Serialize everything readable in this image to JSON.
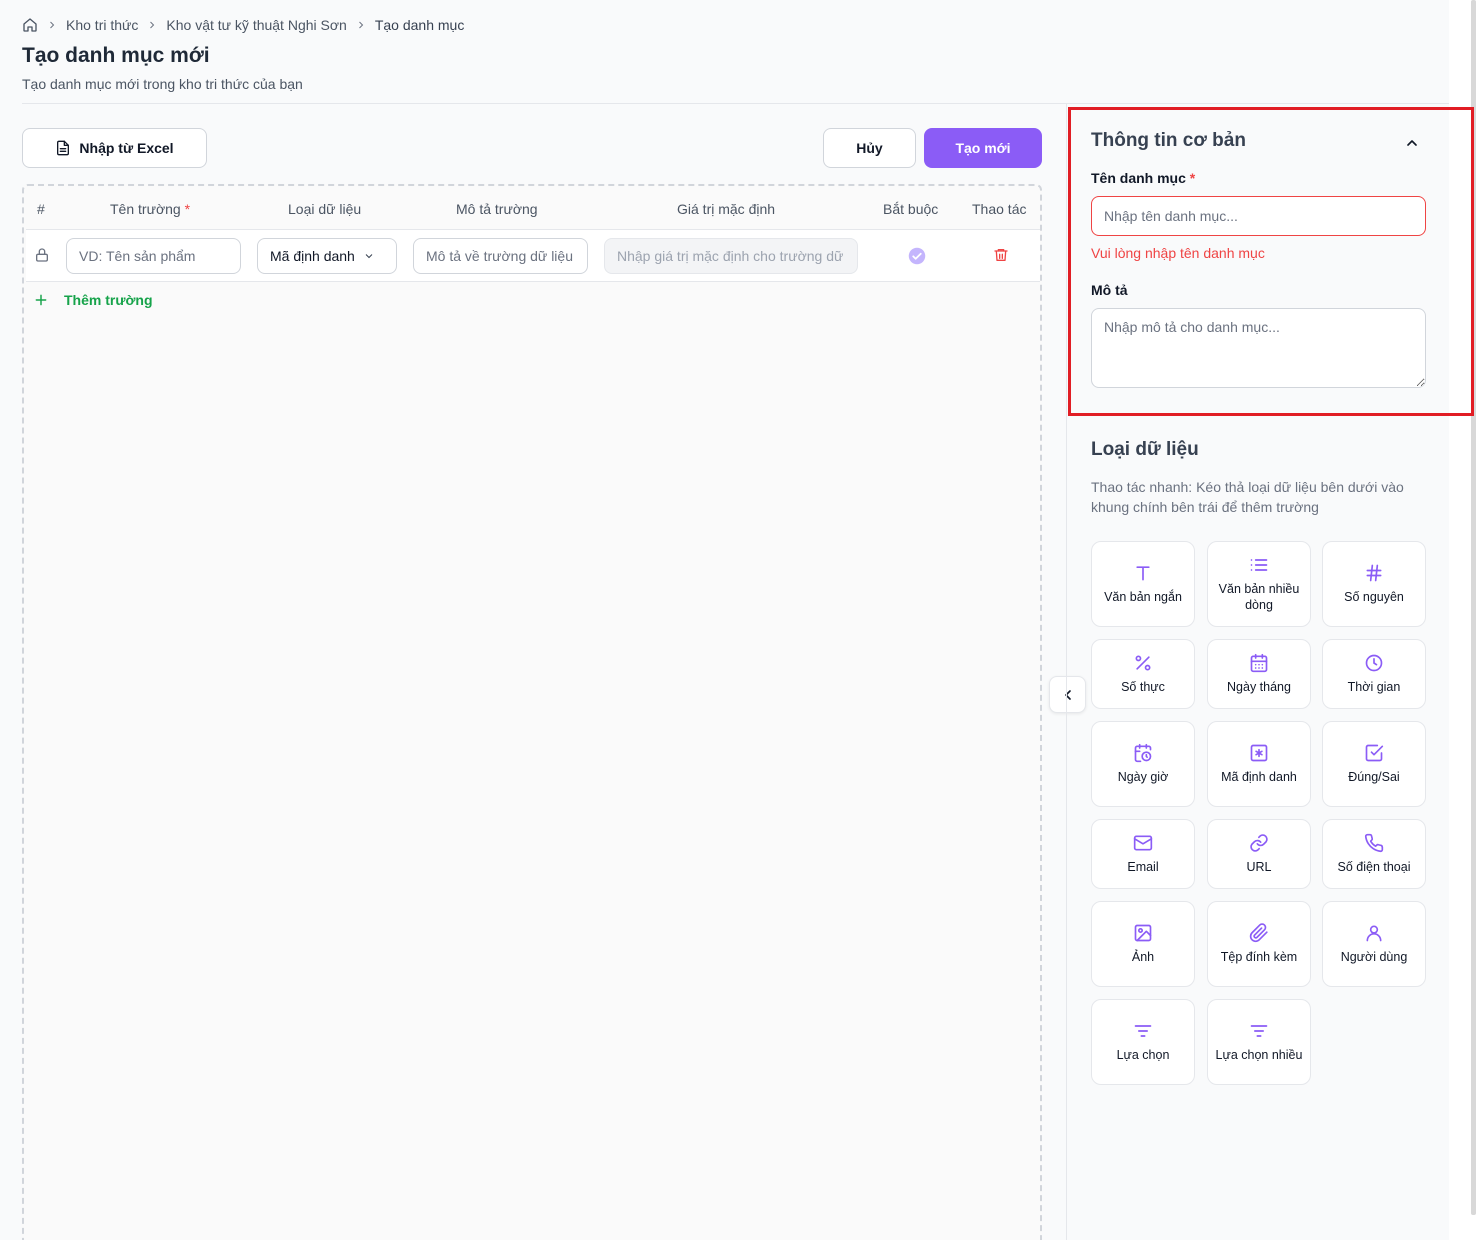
{
  "breadcrumb": {
    "items": [
      "Kho tri thức",
      "Kho vật tư kỹ thuật Nghi Sơn"
    ],
    "current": "Tạo danh mục"
  },
  "page": {
    "title": "Tạo danh mục mới",
    "subtitle": "Tạo danh mục mới trong kho tri thức của bạn"
  },
  "toolbar": {
    "import_label": "Nhập từ Excel",
    "cancel_label": "Hủy",
    "create_label": "Tạo mới"
  },
  "table": {
    "headers": {
      "index": "#",
      "field_name": "Tên trường",
      "data_type": "Loại dữ liệu",
      "description": "Mô tả trường",
      "default_value": "Giá trị mặc định",
      "required": "Bắt buộc",
      "actions": "Thao tác"
    },
    "required_mark": "*",
    "row": {
      "name_placeholder": "VD: Tên sản phẩm",
      "type_value": "Mã định danh",
      "description_placeholder": "Mô tả về trường dữ liệu",
      "default_placeholder": "Nhập giá trị mặc định cho trường dữ liệu"
    },
    "add_field_label": "Thêm trường"
  },
  "basic_info": {
    "title": "Thông tin cơ bản",
    "name_label": "Tên danh mục",
    "required_mark": "*",
    "name_placeholder": "Nhập tên danh mục...",
    "name_error": "Vui lòng nhập tên danh mục",
    "description_label": "Mô tả",
    "description_placeholder": "Nhập mô tả cho danh mục..."
  },
  "data_types": {
    "title": "Loại dữ liệu",
    "hint": "Thao tác nhanh: Kéo thả loại dữ liệu bên dưới vào khung chính bên trái để thêm trường",
    "items": [
      {
        "label": "Văn bản ngắn",
        "icon": "text-icon"
      },
      {
        "label": "Văn bản nhiều dòng",
        "icon": "multiline-text-icon"
      },
      {
        "label": "Số nguyên",
        "icon": "hash-icon"
      },
      {
        "label": "Số thực",
        "icon": "percent-icon"
      },
      {
        "label": "Ngày tháng",
        "icon": "calendar-icon"
      },
      {
        "label": "Thời gian",
        "icon": "clock-icon"
      },
      {
        "label": "Ngày giờ",
        "icon": "calendar-clock-icon"
      },
      {
        "label": "Mã định danh",
        "icon": "asterisk-square-icon"
      },
      {
        "label": "Đúng/Sai",
        "icon": "checkbox-icon"
      },
      {
        "label": "Email",
        "icon": "mail-icon"
      },
      {
        "label": "URL",
        "icon": "link-icon"
      },
      {
        "label": "Số điện thoại",
        "icon": "phone-icon"
      },
      {
        "label": "Ảnh",
        "icon": "image-icon"
      },
      {
        "label": "Tệp đính kèm",
        "icon": "paperclip-icon"
      },
      {
        "label": "Người dùng",
        "icon": "user-icon"
      },
      {
        "label": "Lựa chọn",
        "icon": "filter-icon"
      },
      {
        "label": "Lựa chọn nhiều",
        "icon": "filter-icon"
      }
    ]
  },
  "colors": {
    "accent": "#8b5cf6",
    "danger": "#ef4444",
    "success": "#16a34a",
    "highlight_border": "#e11d24"
  }
}
